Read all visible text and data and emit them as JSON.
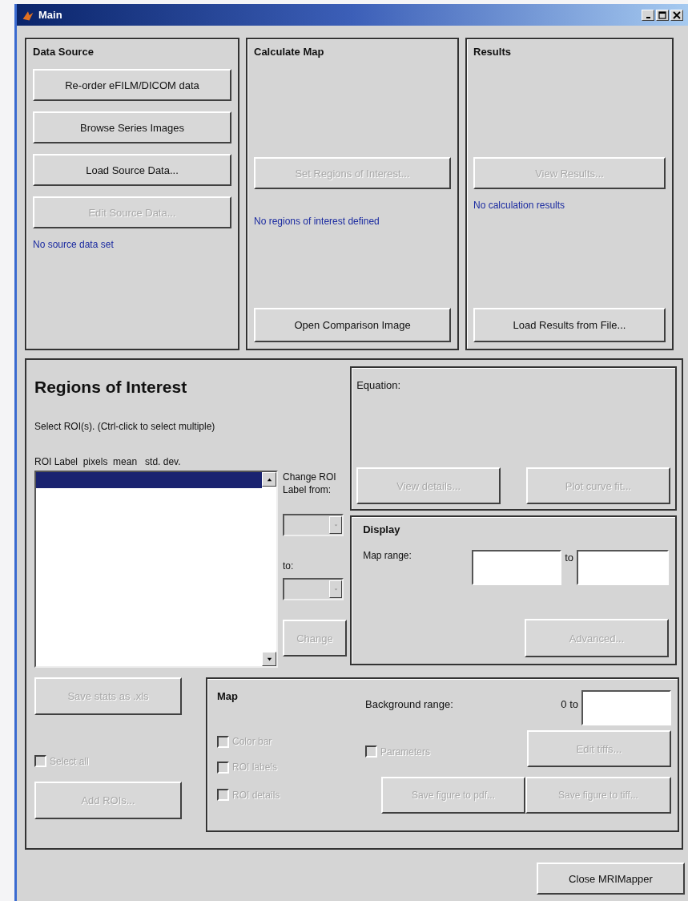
{
  "window": {
    "title": "Main"
  },
  "top_panels": [
    {
      "title": "Data Source",
      "buttons": [
        {
          "label": "Re-order eFILM/DICOM data",
          "disabled": false
        },
        {
          "label": "Browse Series Images",
          "disabled": false
        },
        {
          "label": "Load Source Data...",
          "disabled": false
        },
        {
          "label": "Edit Source Data...",
          "disabled": true
        }
      ],
      "status": "No source data set"
    },
    {
      "title": "Calculate Map",
      "buttons": [
        {
          "label": "Set Regions of Interest...",
          "disabled": true
        }
      ],
      "status": "No regions of interest defined",
      "bottom_button": {
        "label": "Open Comparison Image",
        "disabled": false
      }
    },
    {
      "title": "Results",
      "buttons": [
        {
          "label": "View Results...",
          "disabled": true
        }
      ],
      "status": "No calculation results",
      "bottom_button": {
        "label": "Load Results from File...",
        "disabled": false
      }
    }
  ],
  "roi": {
    "title": "Regions of Interest",
    "instruction": "Select ROI(s). (Ctrl-click to select multiple)",
    "list_header": "ROI Label  pixels  mean   std. dev.",
    "list_rows": [
      {
        "selected": true
      }
    ],
    "change_label": "Change ROI Label from:",
    "from_dropdown": {
      "disabled": true
    },
    "to_label": "to:",
    "to_dropdown": {
      "disabled": true
    },
    "change_button": {
      "label": "Change",
      "disabled": true
    },
    "save_button": {
      "label": "Save stats as .xls",
      "disabled": true
    },
    "select_all": {
      "label": "Select all",
      "checked": false,
      "disabled": true
    },
    "add_button": {
      "label": "Add ROIs...",
      "disabled": true
    }
  },
  "equation": {
    "label": "Equation:",
    "buttons": [
      {
        "label": "View details...",
        "disabled": true
      },
      {
        "label": "Plot curve fit...",
        "disabled": true
      }
    ]
  },
  "display": {
    "title": "Display",
    "range_label": "Map range:",
    "to_label": "to",
    "advanced_button": {
      "label": "Advanced...",
      "disabled": true
    }
  },
  "map": {
    "title": "Map",
    "checkboxes": [
      {
        "label": "Color bar",
        "checked": false,
        "disabled": true
      },
      {
        "label": "ROI labels",
        "checked": false,
        "disabled": true
      },
      {
        "label": "ROI details",
        "checked": false,
        "disabled": true
      }
    ],
    "background_label": "Background range:",
    "background_prefix": "0 to",
    "parameters": {
      "label": "Parameters",
      "checked": false,
      "disabled": true
    },
    "edit_button": {
      "label": "Edit tiffs...",
      "disabled": true
    },
    "pdf_button": {
      "label": "Save figure to pdf...",
      "disabled": true
    },
    "tiff_button": {
      "label": "Save figure to tiff...",
      "disabled": true
    }
  },
  "close_button": {
    "label": "Close MRIMapper",
    "disabled": false
  }
}
